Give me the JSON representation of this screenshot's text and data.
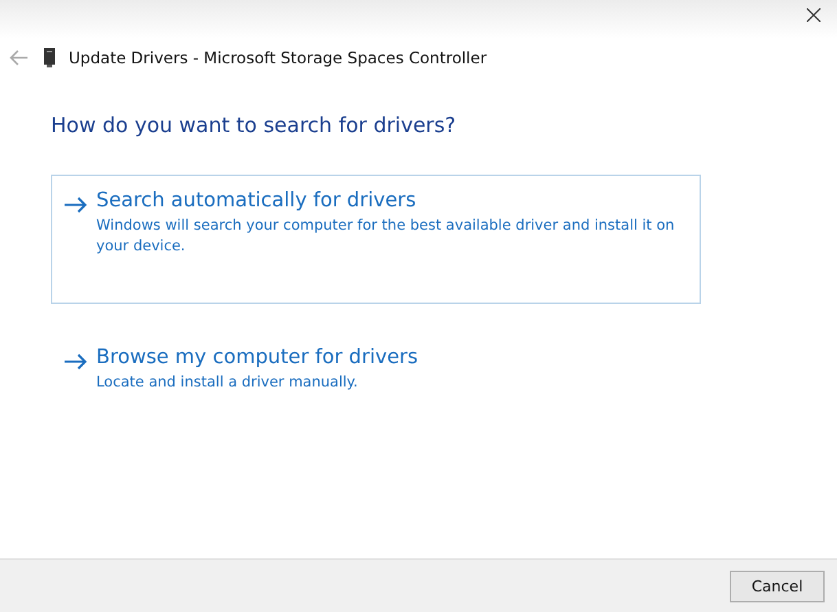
{
  "window": {
    "title": "Update Drivers - Microsoft Storage Spaces Controller"
  },
  "heading": "How do you want to search for drivers?",
  "options": [
    {
      "title": "Search automatically for drivers",
      "description": "Windows will search your computer for the best available driver and install it on your device.",
      "selected": true
    },
    {
      "title": "Browse my computer for drivers",
      "description": "Locate and install a driver manually.",
      "selected": false
    }
  ],
  "buttons": [
    "Cancel"
  ]
}
